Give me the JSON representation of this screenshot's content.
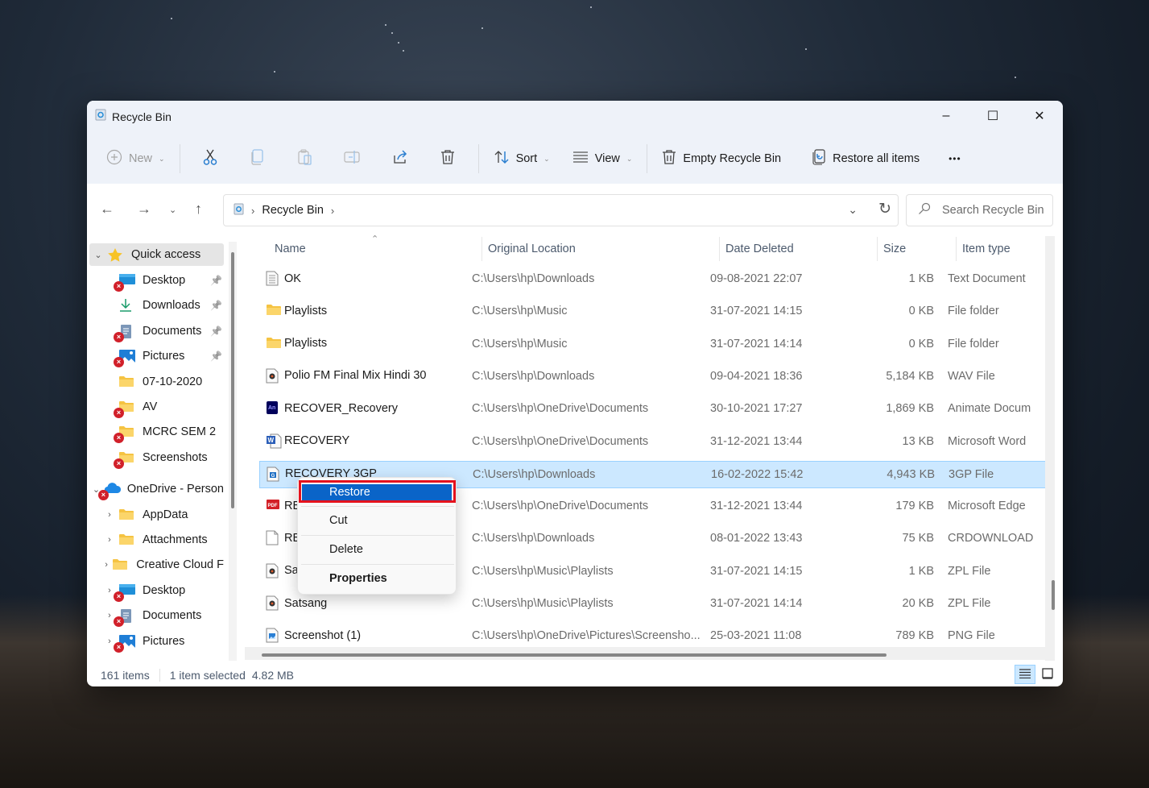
{
  "window": {
    "title": "Recycle Bin",
    "controls": {
      "minimize": "–",
      "maximize": "☐",
      "close": "✕"
    }
  },
  "toolbar": {
    "new_label": "New",
    "sort_label": "Sort",
    "view_label": "View",
    "empty_label": "Empty Recycle Bin",
    "restore_all_label": "Restore all items",
    "more_label": "•••"
  },
  "address": {
    "path": [
      "Recycle Bin"
    ],
    "search_placeholder": "Search Recycle Bin"
  },
  "sidebar": {
    "items": [
      {
        "label": "Quick access",
        "icon": "star-icon",
        "expanded": true
      },
      {
        "label": "Desktop",
        "icon": "desktop-icon",
        "pinned": true,
        "error": true
      },
      {
        "label": "Downloads",
        "icon": "download-icon",
        "pinned": true
      },
      {
        "label": "Documents",
        "icon": "documents-icon",
        "pinned": true,
        "error": true
      },
      {
        "label": "Pictures",
        "icon": "pictures-icon",
        "pinned": true,
        "error": true
      },
      {
        "label": "07-10-2020",
        "icon": "folder-icon"
      },
      {
        "label": "AV",
        "icon": "folder-icon",
        "error": true
      },
      {
        "label": "MCRC SEM 2",
        "icon": "folder-icon",
        "error": true
      },
      {
        "label": "Screenshots",
        "icon": "folder-icon",
        "error": true
      },
      {
        "label": "OneDrive - Person",
        "icon": "onedrive-icon",
        "expanded": true,
        "error": true
      },
      {
        "label": "AppData",
        "icon": "folder-icon"
      },
      {
        "label": "Attachments",
        "icon": "folder-icon"
      },
      {
        "label": "Creative Cloud F",
        "icon": "folder-icon"
      },
      {
        "label": "Desktop",
        "icon": "desktop-icon",
        "error": true
      },
      {
        "label": "Documents",
        "icon": "documents-icon",
        "error": true
      },
      {
        "label": "Pictures",
        "icon": "pictures-icon",
        "error": true
      }
    ]
  },
  "table": {
    "columns": [
      "Name",
      "Original Location",
      "Date Deleted",
      "Size",
      "Item type"
    ],
    "rows": [
      {
        "name": "OK",
        "icon": "text-file-icon",
        "location": "C:\\Users\\hp\\Downloads",
        "date": "09-08-2021 22:07",
        "size": "1 KB",
        "type": "Text Document"
      },
      {
        "name": "Playlists",
        "icon": "folder-icon",
        "location": "C:\\Users\\hp\\Music",
        "date": "31-07-2021 14:15",
        "size": "0 KB",
        "type": "File folder"
      },
      {
        "name": "Playlists",
        "icon": "folder-icon",
        "location": "C:\\Users\\hp\\Music",
        "date": "31-07-2021 14:14",
        "size": "0 KB",
        "type": "File folder"
      },
      {
        "name": "Polio FM Final Mix Hindi 30",
        "icon": "media-file-icon",
        "location": "C:\\Users\\hp\\Downloads",
        "date": "09-04-2021 18:36",
        "size": "5,184 KB",
        "type": "WAV File"
      },
      {
        "name": "RECOVER_Recovery",
        "icon": "animate-file-icon",
        "location": "C:\\Users\\hp\\OneDrive\\Documents",
        "date": "30-10-2021 17:27",
        "size": "1,869 KB",
        "type": "Animate Docum"
      },
      {
        "name": "RECOVERY",
        "icon": "word-file-icon",
        "location": "C:\\Users\\hp\\OneDrive\\Documents",
        "date": "31-12-2021 13:44",
        "size": "13 KB",
        "type": "Microsoft Word"
      },
      {
        "name": "RECOVERY 3GP",
        "icon": "video-file-icon",
        "location": "C:\\Users\\hp\\Downloads",
        "date": "16-02-2022 15:42",
        "size": "4,943 KB",
        "type": "3GP File",
        "selected": true
      },
      {
        "name": "RE",
        "icon": "pdf-file-icon",
        "location": "C:\\Users\\hp\\OneDrive\\Documents",
        "date": "31-12-2021 13:44",
        "size": "179 KB",
        "type": "Microsoft Edge"
      },
      {
        "name": "RE",
        "icon": "blank-file-icon",
        "location": "C:\\Users\\hp\\Downloads",
        "date": "08-01-2022 13:43",
        "size": "75 KB",
        "type": "CRDOWNLOAD"
      },
      {
        "name": "Sa",
        "icon": "media-file-icon",
        "location": "C:\\Users\\hp\\Music\\Playlists",
        "date": "31-07-2021 14:15",
        "size": "1 KB",
        "type": "ZPL File"
      },
      {
        "name": "Satsang",
        "icon": "media-file-icon",
        "location": "C:\\Users\\hp\\Music\\Playlists",
        "date": "31-07-2021 14:14",
        "size": "20 KB",
        "type": "ZPL File"
      },
      {
        "name": "Screenshot (1)",
        "icon": "image-file-icon",
        "location": "C:\\Users\\hp\\OneDrive\\Pictures\\Screensho...",
        "date": "25-03-2021 11:08",
        "size": "789 KB",
        "type": "PNG File"
      }
    ]
  },
  "context_menu": {
    "items": [
      "Restore",
      "Cut",
      "Delete",
      "Properties"
    ],
    "highlighted": "Restore"
  },
  "status": {
    "item_count": "161 items",
    "selection": "1 item selected",
    "selection_size": "4.82 MB"
  },
  "colors": {
    "accent": "#0a64c8",
    "selection_bg": "#cce8ff",
    "highlight_box": "#e5121d"
  }
}
